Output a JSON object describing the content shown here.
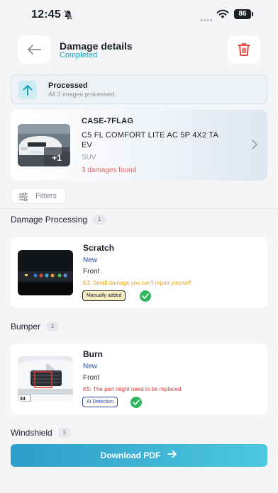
{
  "status_bar": {
    "time": "12:45",
    "battery": "86"
  },
  "header": {
    "title": "Damage details",
    "subtitle": "Completed"
  },
  "processed": {
    "title": "Processed",
    "text": "All 2 images processed."
  },
  "case": {
    "id": "CASE-7FLAG",
    "model": "C5 FL COMFORT LITE AC 5P 4X2 TA EV",
    "type": "SUV",
    "damages": "3 damages found",
    "more_images": "+1"
  },
  "filters": {
    "label": "Filters"
  },
  "sections": [
    {
      "label": "Damage Processing",
      "count": "1"
    },
    {
      "label": "Bumper",
      "count": "1"
    },
    {
      "label": "Windshield",
      "count": "1"
    }
  ],
  "damages": [
    {
      "name": "Scratch",
      "status": "New",
      "position": "Front",
      "note": "K3: Small damage you can't repair yourself",
      "note_color": "#e6a317",
      "badge": "Manually added"
    },
    {
      "name": "Burn",
      "status": "New",
      "position": "Front",
      "note": "K5: The part might need to be replaced",
      "note_color": "#d63a3a",
      "badge": "AI Detection"
    }
  ],
  "download": {
    "label": "Download PDF"
  },
  "colors": {
    "accent": "#17a2b8",
    "delete": "#e53935",
    "success": "#2fb85f"
  }
}
